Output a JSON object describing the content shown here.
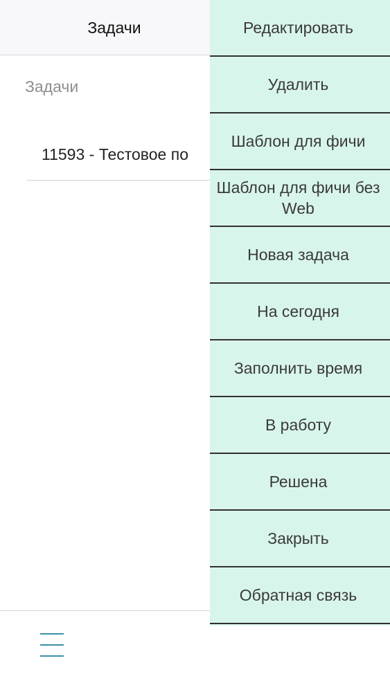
{
  "navbar": {
    "title": "Задачи"
  },
  "list": {
    "section_header": "Задачи",
    "items": [
      {
        "label": "11593 - Тестовое по"
      }
    ]
  },
  "actions": [
    {
      "label": "Редактировать"
    },
    {
      "label": "Удалить"
    },
    {
      "label": "Шаблон для фичи"
    },
    {
      "label": "Шаблон для фичи без Web"
    },
    {
      "label": "Новая задача"
    },
    {
      "label": "На сегодня"
    },
    {
      "label": "Заполнить время"
    },
    {
      "label": "В работу"
    },
    {
      "label": "Решена"
    },
    {
      "label": "Закрыть"
    },
    {
      "label": "Обратная связь"
    }
  ],
  "tabbar": {
    "icon": "hamburger-menu-icon"
  },
  "colors": {
    "action_panel_bg": "#d8f5ec",
    "accent": "#3a8fa8"
  }
}
